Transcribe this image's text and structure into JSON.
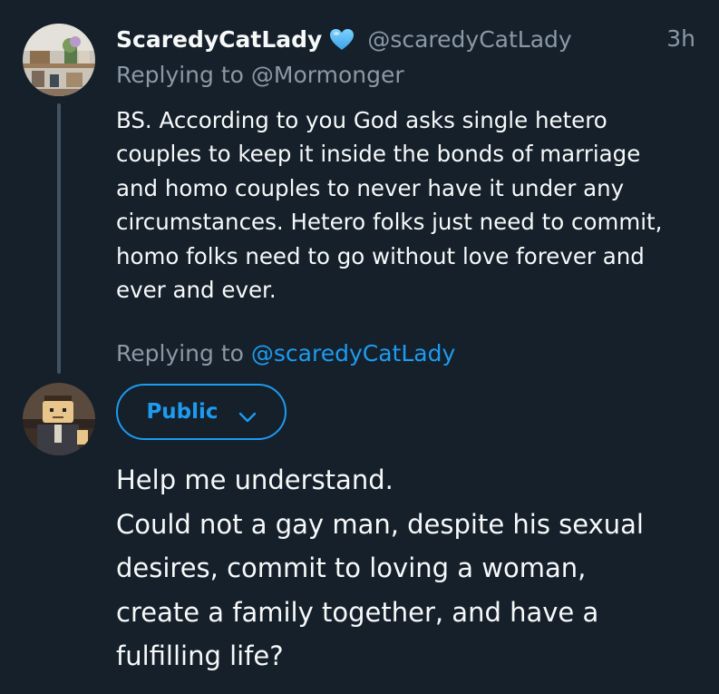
{
  "parent_tweet": {
    "display_name": "ScaredyCatLady",
    "verified_icon": "blue-heart-icon",
    "handle": "@scaredyCatLady",
    "timestamp": "3h",
    "replying_to_prefix": "Replying to",
    "replying_to_handle": "@Mormonger",
    "body_lines": [
      "BS. According to you God asks single hetero",
      "couples to keep it inside the bonds of marriage",
      "and homo couples to never have it under any",
      "circumstances. Hetero folks just need to commit,",
      "homo folks need to go without love forever and",
      "ever and ever."
    ]
  },
  "reply_composer": {
    "replying_to_prefix": "Replying to",
    "replying_to_handle": "@scaredyCatLady",
    "audience_label": "Public",
    "audience_icon": "chevron-down-icon",
    "body_lines": [
      "Help me understand.",
      "Could not a gay man, despite his sexual",
      "desires, commit to loving a woman,",
      "create a family together, and have a",
      "fulfilling life?"
    ]
  },
  "colors": {
    "background": "#15202b",
    "text": "#f7f9f9",
    "muted": "#8b98a5",
    "accent": "#1d9bf0",
    "thread_line": "#425364"
  }
}
